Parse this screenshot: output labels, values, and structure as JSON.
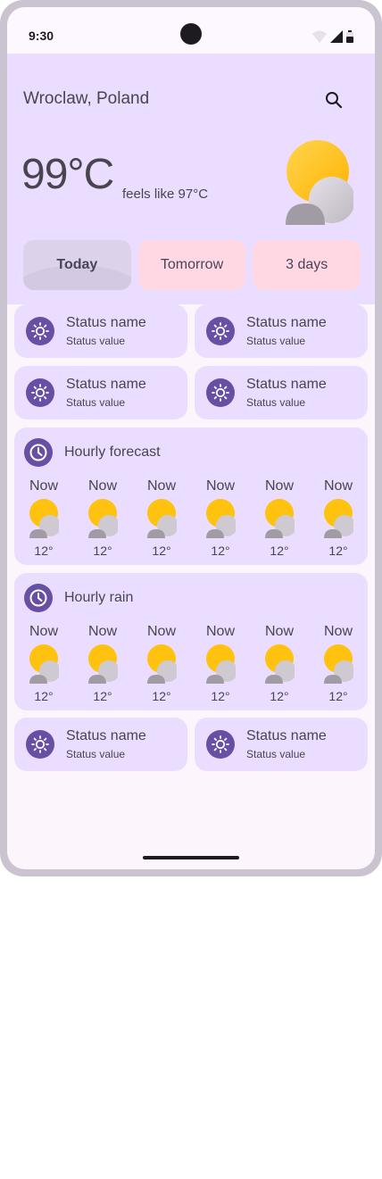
{
  "status_bar": {
    "time": "9:30",
    "icons": [
      "wifi-icon",
      "signal-icon",
      "battery-icon"
    ]
  },
  "header": {
    "location": "Wroclaw, Poland",
    "search_icon": "search-icon",
    "temperature": "99°C",
    "feels_like": "feels like 97°C",
    "weather_icon": "sun-cloud-icon"
  },
  "tabs": [
    {
      "label": "Today",
      "active": true
    },
    {
      "label": "Tomorrow",
      "active": false
    },
    {
      "label": "3 days",
      "active": false
    }
  ],
  "status_cards": [
    {
      "name": "Status name",
      "value": "Status value",
      "icon": "sun-icon"
    },
    {
      "name": "Status name",
      "value": "Status value",
      "icon": "sun-icon"
    },
    {
      "name": "Status name",
      "value": "Status value",
      "icon": "sun-icon"
    },
    {
      "name": "Status name",
      "value": "Status value",
      "icon": "sun-icon"
    },
    {
      "name": "Status name",
      "value": "Status value",
      "icon": "sun-icon"
    },
    {
      "name": "Status name",
      "value": "Status value",
      "icon": "sun-icon"
    }
  ],
  "hourly_forecast": {
    "title": "Hourly forecast",
    "icon": "clock-icon",
    "items": [
      {
        "time": "Now",
        "temp": "12°"
      },
      {
        "time": "Now",
        "temp": "12°"
      },
      {
        "time": "Now",
        "temp": "12°"
      },
      {
        "time": "Now",
        "temp": "12°"
      },
      {
        "time": "Now",
        "temp": "12°"
      },
      {
        "time": "Now",
        "temp": "12°"
      }
    ]
  },
  "hourly_rain": {
    "title": "Hourly rain",
    "icon": "clock-icon",
    "items": [
      {
        "time": "Now",
        "temp": "12°"
      },
      {
        "time": "Now",
        "temp": "12°"
      },
      {
        "time": "Now",
        "temp": "12°"
      },
      {
        "time": "Now",
        "temp": "12°"
      },
      {
        "time": "Now",
        "temp": "12°"
      },
      {
        "time": "Now",
        "temp": "12°"
      }
    ]
  },
  "colors": {
    "primary": "#6750a4",
    "surface": "#eaddff",
    "tab_inactive": "#ffd8e4",
    "sun": "#ffc20e"
  }
}
